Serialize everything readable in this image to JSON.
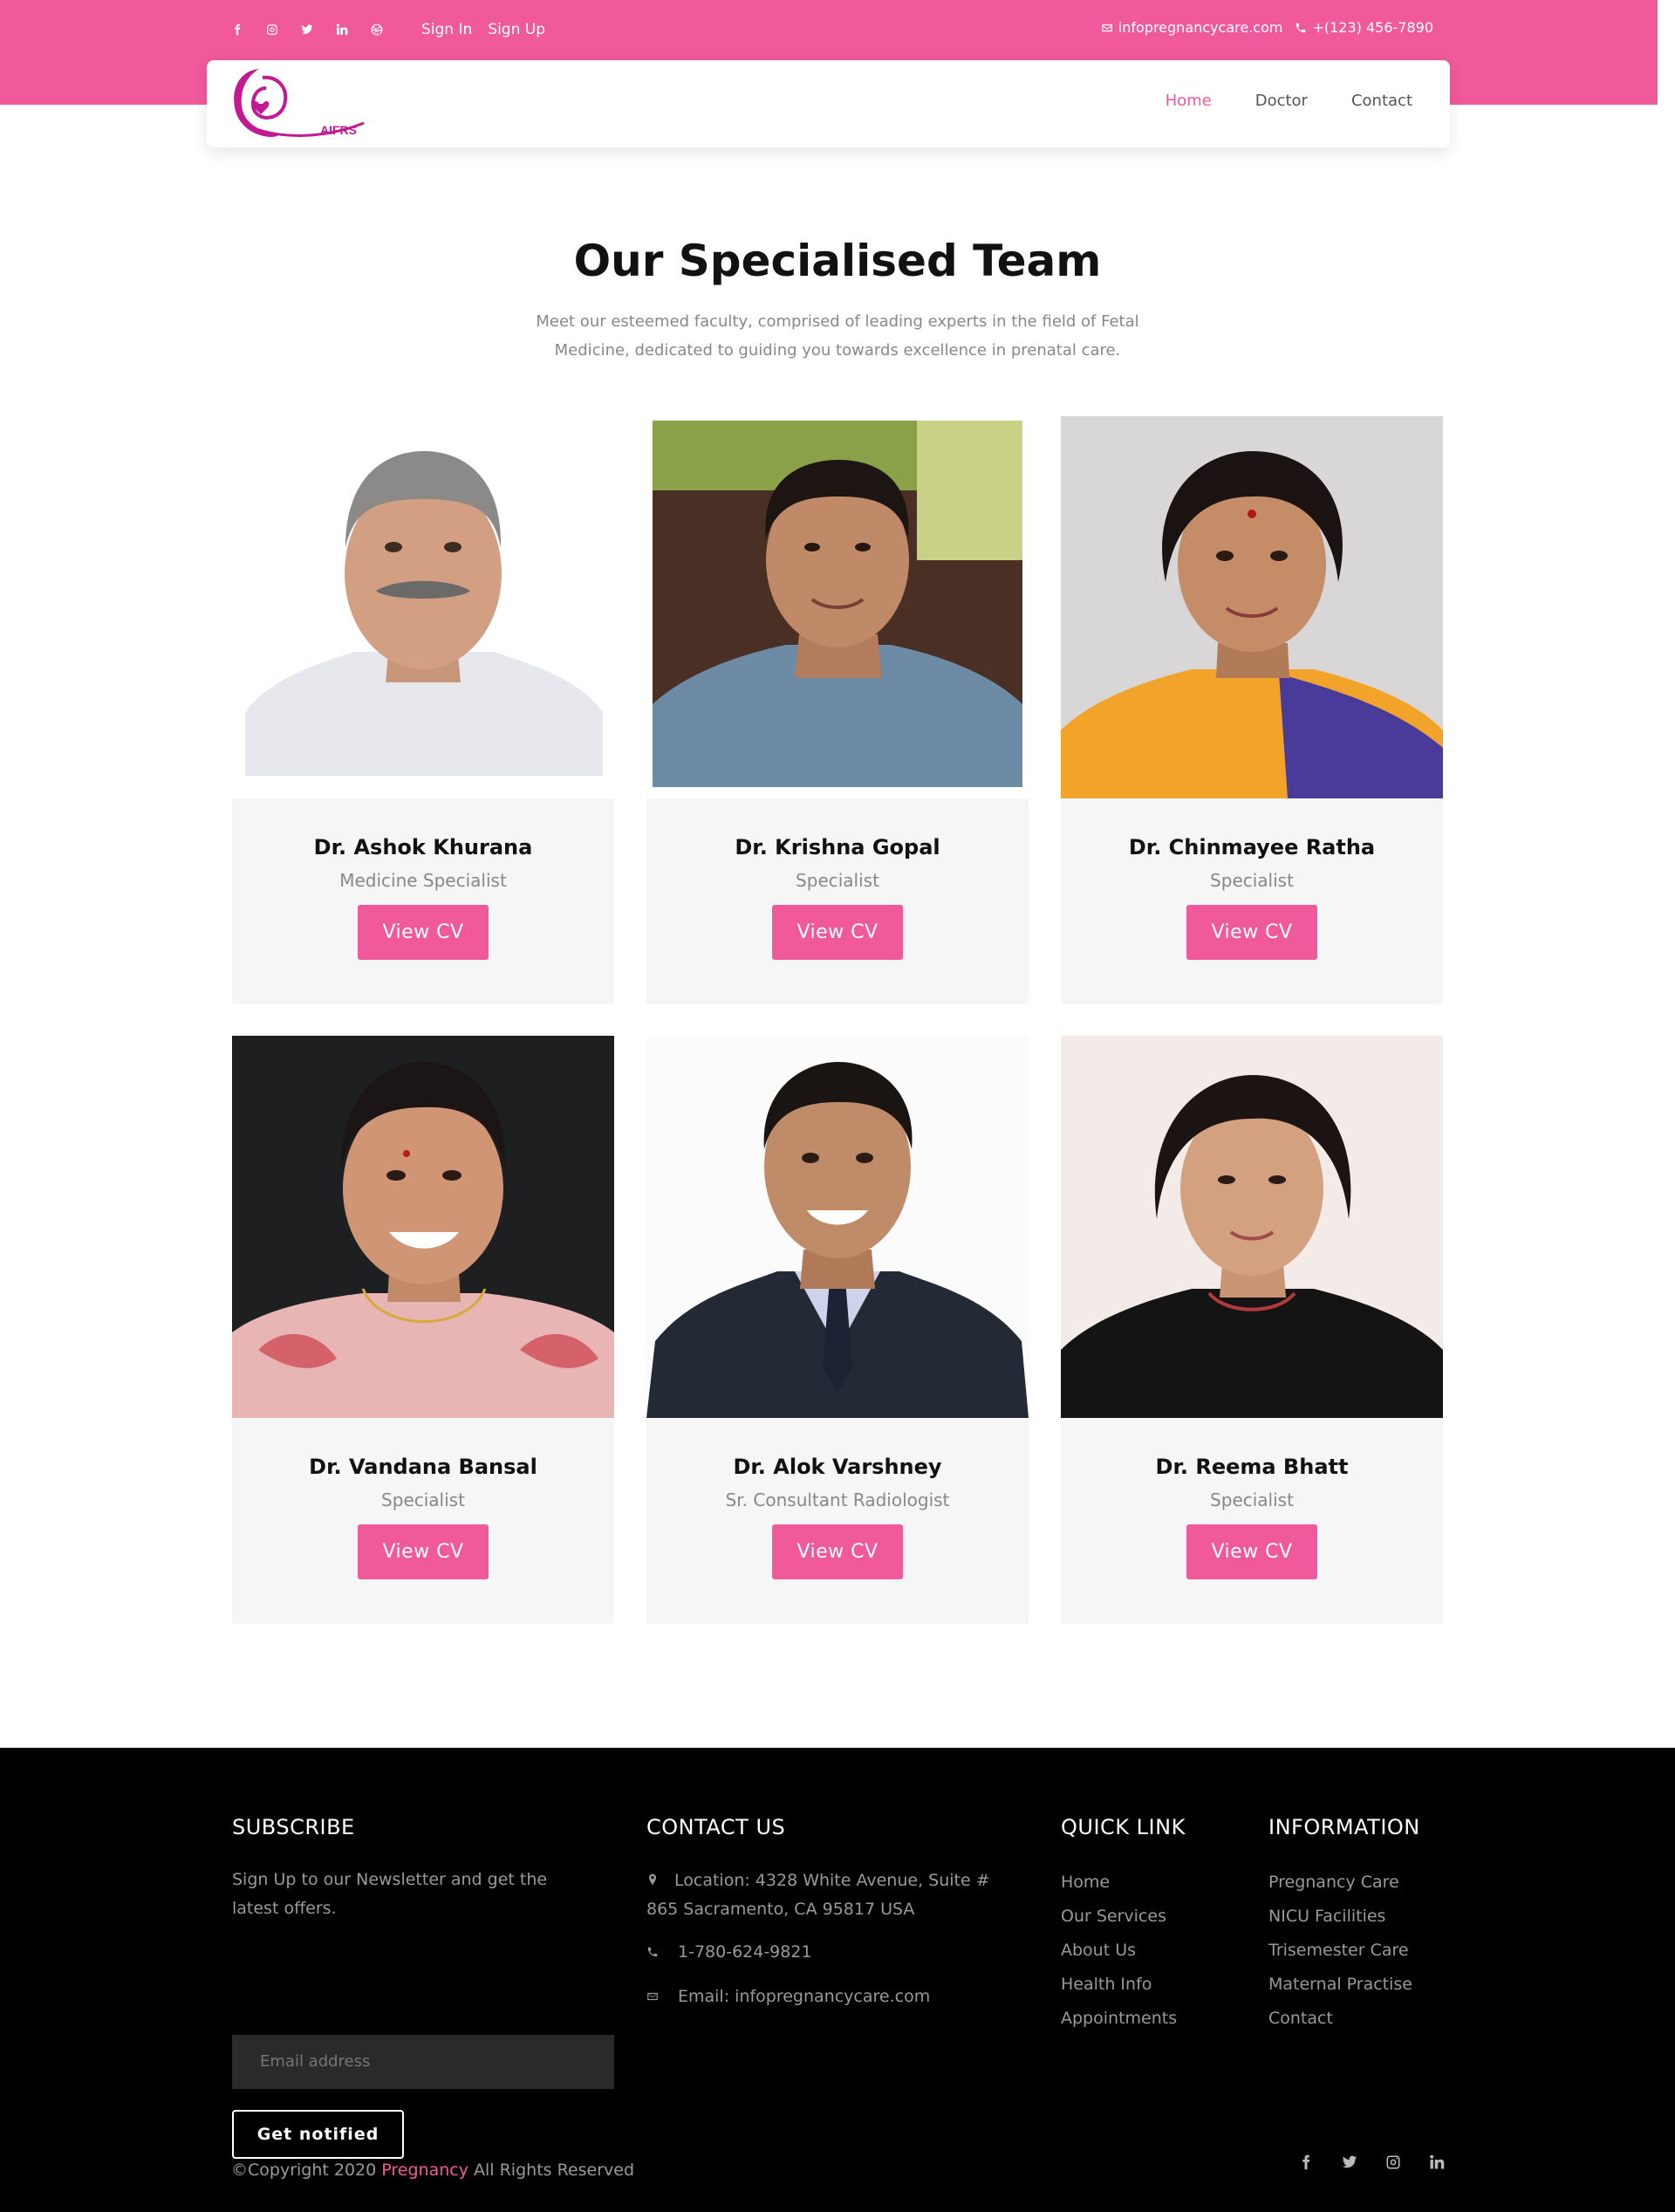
{
  "topbar": {
    "social": [
      "facebook-icon",
      "instagram-icon",
      "twitter-icon",
      "linkedin-icon",
      "dribbble-icon"
    ],
    "sign_in": "Sign In",
    "sign_up": "Sign Up",
    "email": "infopregnancycare.com",
    "phone": "+(123) 456-7890"
  },
  "logo": {
    "text": "AIFRS"
  },
  "nav": {
    "items": [
      {
        "label": "Home",
        "active": true
      },
      {
        "label": "Doctor",
        "active": false
      },
      {
        "label": "Contact",
        "active": false
      }
    ]
  },
  "team": {
    "title": "Our Specialised Team",
    "subtitle": "Meet our esteemed faculty, comprised of leading experts in the field of Fetal Medicine, dedicated to guiding you towards excellence in prenatal care.",
    "members": [
      {
        "name": "Dr. Ashok Khurana",
        "role": "Medicine Specialist",
        "button": "View CV"
      },
      {
        "name": "Dr. Krishna Gopal",
        "role": "Specialist",
        "button": "View CV"
      },
      {
        "name": "Dr. Chinmayee Ratha",
        "role": "Specialist",
        "button": "View CV"
      },
      {
        "name": "Dr. Vandana Bansal",
        "role": "Specialist",
        "button": "View CV"
      },
      {
        "name": "Dr. Alok Varshney",
        "role": "Sr. Consultant Radiologist",
        "button": "View CV"
      },
      {
        "name": "Dr. Reema Bhatt",
        "role": "Specialist",
        "button": "View CV"
      }
    ]
  },
  "footer": {
    "subscribe": {
      "heading": "SUBSCRIBE",
      "text": "Sign Up to our Newsletter and get the latest offers.",
      "email_placeholder": "Email address",
      "button": "Get notified"
    },
    "contact": {
      "heading": "CONTACT US",
      "location": "Location: 4328 White Avenue, Suite # 865 Sacramento, CA 95817 USA",
      "phone": "1-780-624-9821",
      "email": "Email: infopregnancycare.com"
    },
    "quick_link": {
      "heading": "QUICK LINK",
      "items": [
        "Home",
        "Our Services",
        "About Us",
        "Health Info",
        "Appointments"
      ]
    },
    "information": {
      "heading": "INFORMATION",
      "items": [
        "Pregnancy Care",
        "NICU Facilities",
        "Trisemester Care",
        "Maternal Practise",
        "Contact"
      ]
    },
    "copyright_prefix": "©Copyright 2020",
    "copyright_brand": "Pregnancy",
    "copyright_suffix": "All Rights Reserved",
    "social": [
      "facebook-icon",
      "twitter-icon",
      "instagram-icon",
      "linkedin-icon"
    ]
  },
  "colors": {
    "accent": "#f0599a",
    "footer_bg": "#000000",
    "card_bg": "#f6f6f6"
  }
}
